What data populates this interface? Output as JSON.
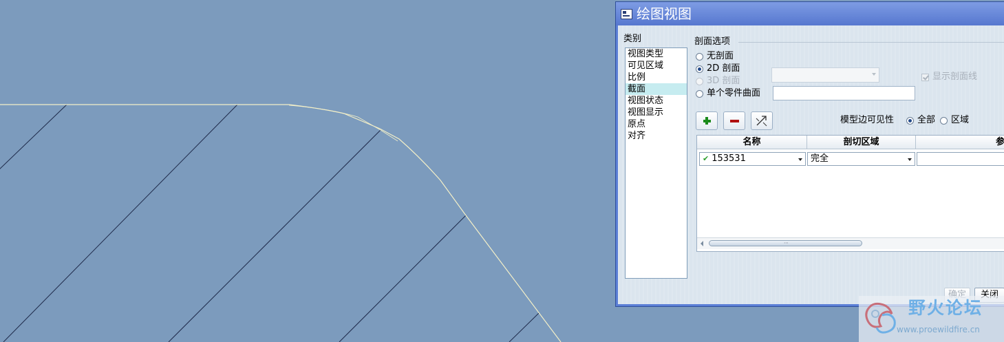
{
  "dialog": {
    "title": "绘图视图",
    "category_label": "类别",
    "categories": [
      "视图类型",
      "可见区域",
      "比例",
      "截面",
      "视图状态",
      "视图显示",
      "原点",
      "对齐"
    ],
    "selected_category": "截面",
    "section_options": {
      "group_label": "剖面选项",
      "none_label": "无剖面",
      "two_d_label": "2D 剖面",
      "three_d_label": "3D 剖面",
      "single_part_label": "单个零件曲面",
      "selected": "2D 剖面",
      "show_hatch_label": "显示剖面线",
      "show_hatch_checked": true
    },
    "toolbar": {
      "add_icon": "plus-icon",
      "remove_icon": "minus-icon",
      "flip_icon": "flip-arrow-icon"
    },
    "edge_visibility": {
      "label": "模型边可见性",
      "all_label": "全部",
      "area_label": "区域",
      "selected": "全部"
    },
    "table": {
      "columns": [
        "名称",
        "剖切区域",
        "参"
      ],
      "rows": [
        {
          "name": "153531",
          "region": "完全",
          "ref": ""
        }
      ]
    },
    "buttons": {
      "ok": "确定",
      "close": "关闭"
    }
  },
  "watermark": {
    "title": "野火论坛",
    "url": "www.proewildfire.cn"
  },
  "colors": {
    "canvas_bg": "#7c9bbd",
    "edge_line": "#f4f0c8",
    "hatch_line": "#1e2a4a",
    "title_bar": "#5b7fd6"
  }
}
